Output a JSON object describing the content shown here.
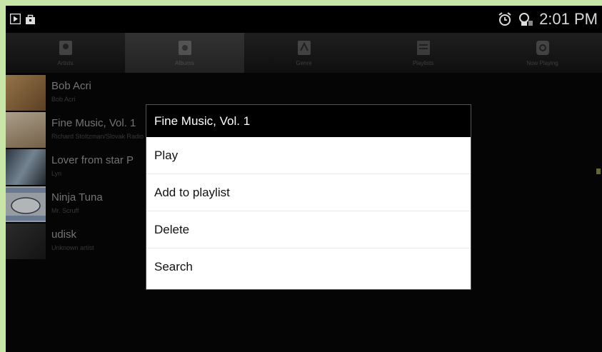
{
  "status_bar": {
    "time": "2:01 PM",
    "left_icons": [
      "play-icon",
      "bag-icon"
    ],
    "right_icons": [
      "alarm-icon",
      "usb-debug-icon"
    ]
  },
  "tabs": [
    {
      "label": "Artists",
      "icon": "artist-icon",
      "active": false
    },
    {
      "label": "Albums",
      "icon": "album-icon",
      "active": true
    },
    {
      "label": "Genre",
      "icon": "genre-icon",
      "active": false
    },
    {
      "label": "Playlists",
      "icon": "playlist-icon",
      "active": false
    },
    {
      "label": "Now Playing",
      "icon": "now-playing-icon",
      "active": false
    }
  ],
  "albums": [
    {
      "title": "Bob Acri",
      "artist": "Bob Acri",
      "thumb_color": "#b08a5a"
    },
    {
      "title": "Fine Music, Vol. 1",
      "artist": "Richard Stoltzman/Slovak Radio Symphony Orchestra",
      "thumb_color": "#c8b090"
    },
    {
      "title": "Lover from star P",
      "artist": "Lyn",
      "thumb_color": "#607080"
    },
    {
      "title": "Ninja Tuna",
      "artist": "Mr. Scruff",
      "thumb_color": "#c0c8d0"
    },
    {
      "title": "udisk",
      "artist": "Unknown artist",
      "thumb_color": "#2a2a2a"
    }
  ],
  "dialog": {
    "title": "Fine Music, Vol. 1",
    "items": [
      "Play",
      "Add to playlist",
      "Delete",
      "Search"
    ]
  }
}
